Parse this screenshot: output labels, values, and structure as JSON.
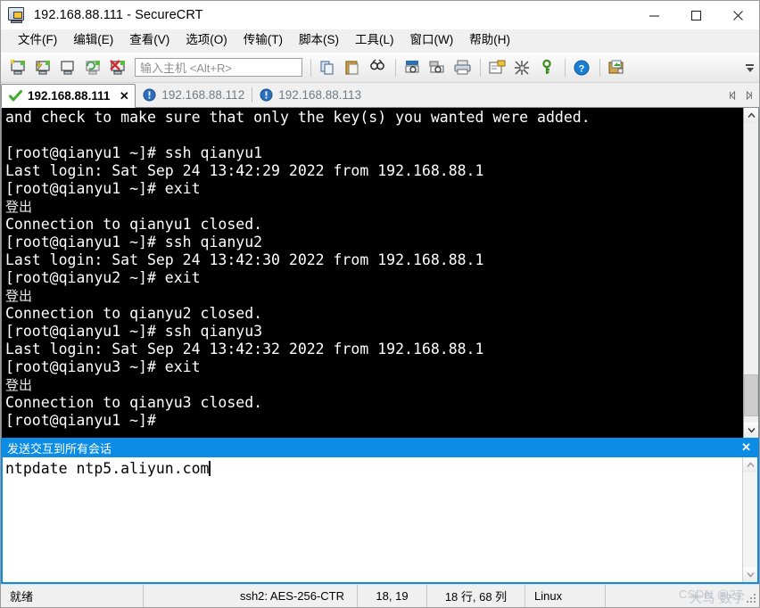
{
  "window": {
    "title": "192.168.88.111 - SecureCRT",
    "icon": "securecrt-lock-icon",
    "controls": {
      "minimize": "minimize-icon",
      "maximize": "maximize-icon",
      "close": "close-icon"
    }
  },
  "menu": {
    "items": [
      {
        "label": "文件(F)",
        "name": "menu-file"
      },
      {
        "label": "编辑(E)",
        "name": "menu-edit"
      },
      {
        "label": "查看(V)",
        "name": "menu-view"
      },
      {
        "label": "选项(O)",
        "name": "menu-options"
      },
      {
        "label": "传输(T)",
        "name": "menu-transfer"
      },
      {
        "label": "脚本(S)",
        "name": "menu-script"
      },
      {
        "label": "工具(L)",
        "name": "menu-tools"
      },
      {
        "label": "窗口(W)",
        "name": "menu-window"
      },
      {
        "label": "帮助(H)",
        "name": "menu-help"
      }
    ]
  },
  "toolbar": {
    "host_placeholder": "输入主机 <Alt+R>",
    "buttons": [
      "new-session-icon",
      "quick-connect-icon",
      "open-session-folder-icon",
      "reconnect-icon",
      "disconnect-icon",
      "copy-icon",
      "paste-icon",
      "find-icon",
      "print-screen-icon",
      "log-session-icon",
      "print-icon",
      "session-options-icon",
      "arrange-sessions-icon",
      "key-icon",
      "help-icon",
      "transfer-window-icon"
    ]
  },
  "tabs": {
    "items": [
      {
        "label": "192.168.88.111",
        "active": true,
        "icon": "connected-check-icon"
      },
      {
        "label": "192.168.88.112",
        "active": false,
        "icon": "disconnected-icon"
      },
      {
        "label": "192.168.88.113",
        "active": false,
        "icon": "disconnected-icon"
      }
    ],
    "close_label": "✕",
    "nav_prev": "tab-scroll-left-icon",
    "nav_next": "tab-scroll-right-icon"
  },
  "terminal": {
    "lines": [
      "and check to make sure that only the key(s) you wanted were added.",
      "",
      "[root@qianyu1 ~]# ssh qianyu1",
      "Last login: Sat Sep 24 13:42:29 2022 from 192.168.88.1",
      "[root@qianyu1 ~]# exit",
      "登出",
      "Connection to qianyu1 closed.",
      "[root@qianyu1 ~]# ssh qianyu2",
      "Last login: Sat Sep 24 13:42:30 2022 from 192.168.88.1",
      "[root@qianyu2 ~]# exit",
      "登出",
      "Connection to qianyu2 closed.",
      "[root@qianyu1 ~]# ssh qianyu3",
      "Last login: Sat Sep 24 13:42:32 2022 from 192.168.88.1",
      "[root@qianyu3 ~]# exit",
      "登出",
      "Connection to qianyu3 closed.",
      "[root@qianyu1 ~]#"
    ],
    "foreground": "#ffffff",
    "background": "#000000"
  },
  "send_bar": {
    "label": "发送交互到所有会话",
    "close_label": "✕",
    "accent": "#0c8ce4"
  },
  "command_input": {
    "value": "ntpdate ntp5.aliyun.com"
  },
  "status_bar": {
    "state": "就绪",
    "cipher": "ssh2: AES-256-CTR",
    "cursor": "18, 19",
    "dimensions": "18 行, 68 列",
    "protocol": "Linux",
    "watermark": "CSDN @27",
    "watermark_overlay": "大鸟 数字"
  }
}
